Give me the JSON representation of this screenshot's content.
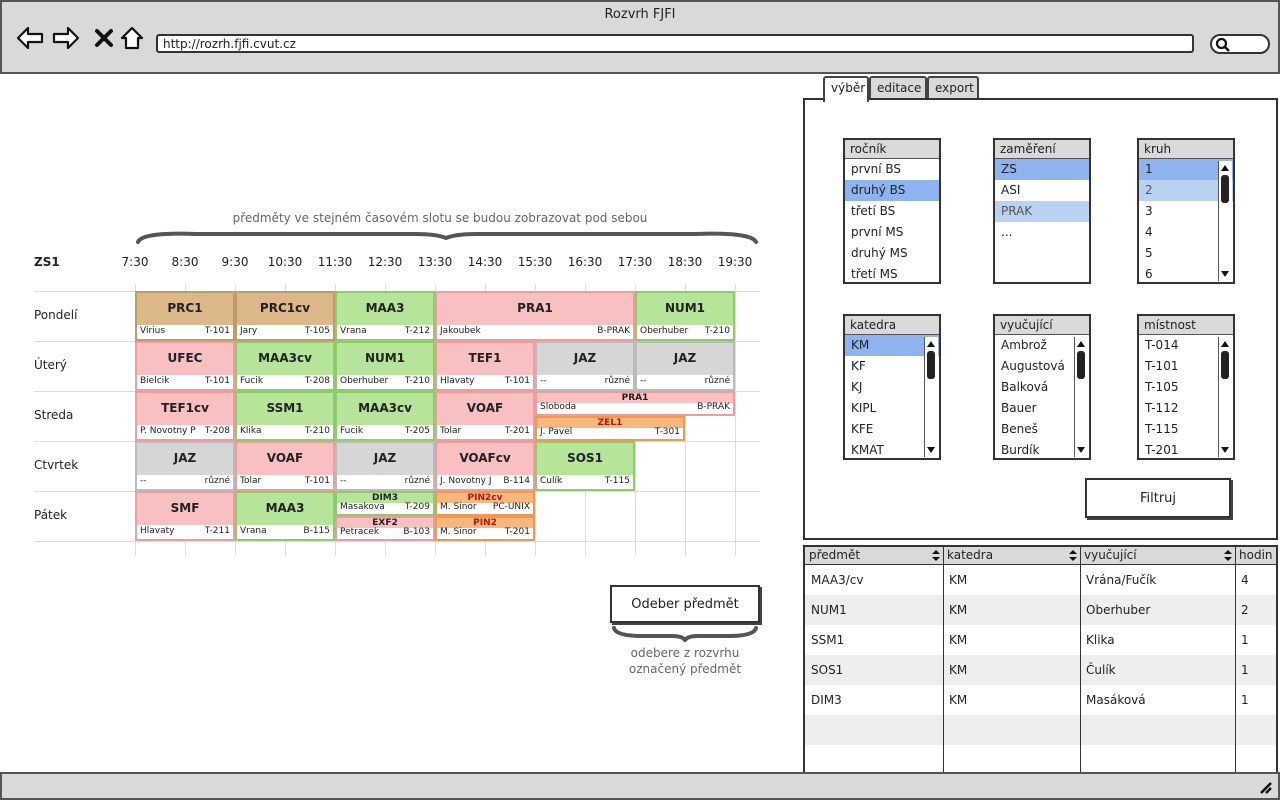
{
  "window": {
    "title": "Rozvrh FJFI",
    "url": "http://rozrh.fjfi.cvut.cz"
  },
  "schedule": {
    "semester": "ZS1",
    "note": "předměty ve stejném časovém slotu se budou zobrazovat pod sebou",
    "times": [
      "7:30",
      "8:30",
      "9:30",
      "10:30",
      "11:30",
      "12:30",
      "13:30",
      "14:30",
      "15:30",
      "16:30",
      "17:30",
      "18:30",
      "19:30"
    ],
    "days": [
      "Pondelí",
      "Úterý",
      "Streda",
      "Ctvrtek",
      "Pátek"
    ],
    "slots": [
      {
        "code": "PRC1",
        "teacher": "Virius",
        "room": "T-101"
      },
      {
        "code": "PRC1cv",
        "teacher": "Jary",
        "room": "T-105"
      },
      {
        "code": "MAA3",
        "teacher": "Vrana",
        "room": "T-212"
      },
      {
        "code": "PRA1",
        "teacher": "Jakoubek",
        "room": "B-PRAK"
      },
      {
        "code": "NUM1",
        "teacher": "Oberhuber",
        "room": "T-210"
      },
      {
        "code": "UFEC",
        "teacher": "Bielcik",
        "room": "T-101"
      },
      {
        "code": "MAA3cv",
        "teacher": "Fucik",
        "room": "T-208"
      },
      {
        "code": "NUM1",
        "teacher": "Oberhuber",
        "room": "T-210"
      },
      {
        "code": "TEF1",
        "teacher": "Hlavaty",
        "room": "T-101"
      },
      {
        "code": "JAZ",
        "teacher": "--",
        "room": "různé"
      },
      {
        "code": "JAZ",
        "teacher": "--",
        "room": "různé"
      },
      {
        "code": "TEF1cv",
        "teacher": "P. Novotny P",
        "room": "T-208"
      },
      {
        "code": "SSM1",
        "teacher": "Klika",
        "room": "T-210"
      },
      {
        "code": "MAA3cv",
        "teacher": "Fucik",
        "room": "T-205"
      },
      {
        "code": "VOAF",
        "teacher": "Tolar",
        "room": "T-201"
      },
      {
        "code": "PRA1",
        "teacher": "Sloboda",
        "room": "B-PRAK"
      },
      {
        "code": "ZEL1",
        "teacher": "J. Pavel",
        "room": "T-301"
      },
      {
        "code": "JAZ",
        "teacher": "--",
        "room": "různé"
      },
      {
        "code": "VOAF",
        "teacher": "Tolar",
        "room": "T-101"
      },
      {
        "code": "JAZ",
        "teacher": "--",
        "room": "různé"
      },
      {
        "code": "VOAFcv",
        "teacher": "J. Novotny J",
        "room": "B-114"
      },
      {
        "code": "SOS1",
        "teacher": "Culík",
        "room": "T-115"
      },
      {
        "code": "SMF",
        "teacher": "Hlavaty",
        "room": "T-211"
      },
      {
        "code": "MAA3",
        "teacher": "Vrana",
        "room": "B-115"
      },
      {
        "code": "DIM3",
        "teacher": "Masakova",
        "room": "T-209"
      },
      {
        "code": "EXF2",
        "teacher": "Petracek",
        "room": "B-103"
      },
      {
        "code": "PIN2cv",
        "teacher": "M. Sinor",
        "room": "PC-UNIX"
      },
      {
        "code": "PIN2",
        "teacher": "M. Sinor",
        "room": "T-201"
      }
    ],
    "remove_button": "Odeber předmět",
    "remove_note_1": "odebere z rozvrhu",
    "remove_note_2": "označený předmět"
  },
  "tabs": [
    "výběr",
    "editace",
    "export"
  ],
  "filters": {
    "rocnik": {
      "label": "ročník",
      "items": [
        "první BS",
        "druhý BS",
        "třetí BS",
        "první MS",
        "druhý MS",
        "třetí MS"
      ]
    },
    "zamereni": {
      "label": "zaměření",
      "items": [
        "ZS",
        "ASI",
        "PRAK",
        "..."
      ]
    },
    "kruh": {
      "label": "kruh",
      "items": [
        "1",
        "2",
        "3",
        "4",
        "5",
        "6"
      ]
    },
    "katedra": {
      "label": "katedra",
      "items": [
        "KM",
        "KF",
        "KJ",
        "KIPL",
        "KFE",
        "KMAT"
      ]
    },
    "vyucujici": {
      "label": "vyučující",
      "items": [
        "Ambrož",
        "Augustová",
        "Balková",
        "Bauer",
        "Beneš",
        "Burdík"
      ]
    },
    "mistnost": {
      "label": "místnost",
      "items": [
        "T-014",
        "T-101",
        "T-105",
        "T-112",
        "T-115",
        "T-201"
      ]
    },
    "filter_button": "Filtruj"
  },
  "table": {
    "headers": [
      "předmět",
      "katedra",
      "vyučující",
      "hodin"
    ],
    "rows": [
      [
        "MAA3/cv",
        "KM",
        "Vrána/Fučík",
        "4"
      ],
      [
        "NUM1",
        "KM",
        "Oberhuber",
        "2"
      ],
      [
        "SSM1",
        "KM",
        "Klika",
        "1"
      ],
      [
        "SOS1",
        "KM",
        "Čulík",
        "1"
      ],
      [
        "DIM3",
        "KM",
        "Masáková",
        "1"
      ]
    ]
  }
}
